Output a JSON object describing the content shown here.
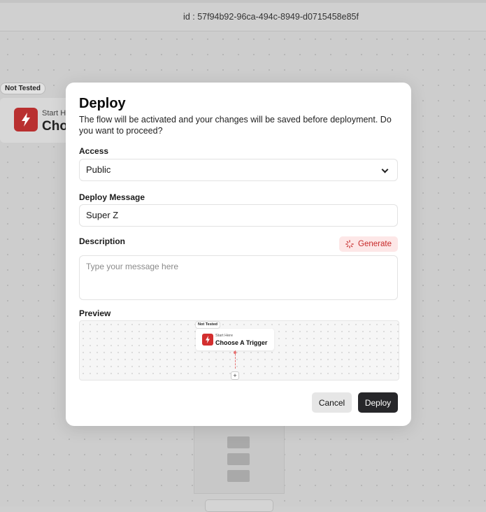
{
  "header": {
    "flow_id": "id : 57f94b92-96ca-494c-8949-d0715458e85f"
  },
  "background_node": {
    "badge": "Not Tested",
    "subtitle": "Start H",
    "title": "Cho",
    "icon": "bolt-icon"
  },
  "modal": {
    "title": "Deploy",
    "description": "The flow will be activated and your changes will be saved before deployment. Do you want to proceed?",
    "access": {
      "label": "Access",
      "value": "Public",
      "icon": "chevron-down-icon"
    },
    "deploy_message": {
      "label": "Deploy Message",
      "value": "Super Z"
    },
    "description_field": {
      "label": "Description",
      "placeholder": "Type your message here",
      "value": ""
    },
    "generate_button": {
      "label": "Generate",
      "icon": "sparkle-loader-icon"
    },
    "preview": {
      "label": "Preview",
      "badge": "Not Tested",
      "node_subtitle": "Start Here",
      "node_title": "Choose A Trigger",
      "add_label": "+"
    },
    "cancel_label": "Cancel",
    "deploy_label": "Deploy"
  },
  "colors": {
    "accent_red": "#d32f2f",
    "generate_bg": "#fde7e7",
    "deploy_button_bg": "#27272a"
  }
}
